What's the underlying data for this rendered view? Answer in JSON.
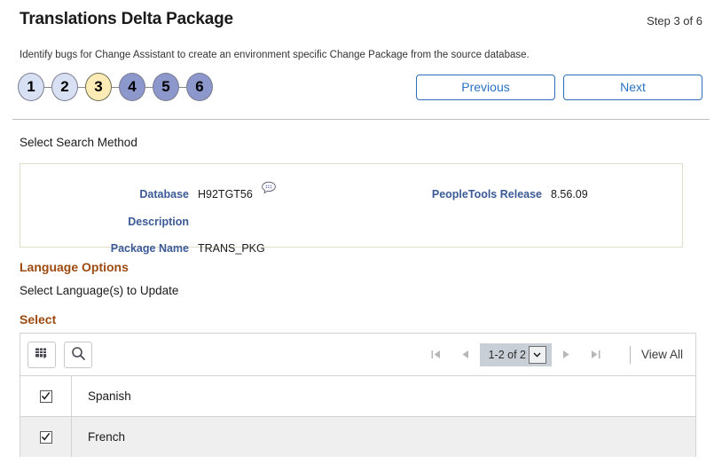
{
  "header": {
    "title": "Translations Delta Package",
    "step_counter": "Step 3 of 6",
    "intro": "Identify bugs for Change Assistant to create an environment specific Change Package from the source database."
  },
  "steps": {
    "nodes": [
      {
        "label": "1",
        "state": "done"
      },
      {
        "label": "2",
        "state": "done"
      },
      {
        "label": "3",
        "state": "current"
      },
      {
        "label": "4",
        "state": "todo"
      },
      {
        "label": "5",
        "state": "todo"
      },
      {
        "label": "6",
        "state": "todo"
      }
    ],
    "colors": {
      "done": "#d7e1f3",
      "current": "#fdecb6",
      "todo": "#8c97cb"
    }
  },
  "nav": {
    "previous_label": "Previous",
    "next_label": "Next",
    "accent": "#2a72c4"
  },
  "search_method": {
    "section_label": "Select Search Method"
  },
  "info_box": {
    "database_label": "Database",
    "database_value": "H92TGT56",
    "comment_icon": "comment-bubble-icon",
    "peopletools_label": "PeopleTools Release",
    "peopletools_value": "8.56.09",
    "description_label": "Description",
    "description_value": "",
    "package_label": "Package Name",
    "package_value": "TRANS_PKG",
    "label_color": "#3c5a96",
    "border_color": "#e3dcc8"
  },
  "language_options": {
    "heading": "Language Options",
    "subtitle": "Select Language(s) to Update",
    "select_heading": "Select",
    "heading_color": "#9c4a10"
  },
  "grid": {
    "toolbar": {
      "grid_export_icon": "grid-download-icon",
      "search_icon": "search-icon"
    },
    "pager": {
      "first_icon": "first-page-icon",
      "prev_icon": "previous-page-icon",
      "count_label": "1-2 of 2",
      "dropdown_icon": "chevron-down-icon",
      "next_icon": "next-page-icon",
      "last_icon": "last-page-icon",
      "view_all_label": "View All"
    },
    "rows": [
      {
        "checked": true,
        "label": "Spanish"
      },
      {
        "checked": true,
        "label": "French"
      }
    ]
  }
}
